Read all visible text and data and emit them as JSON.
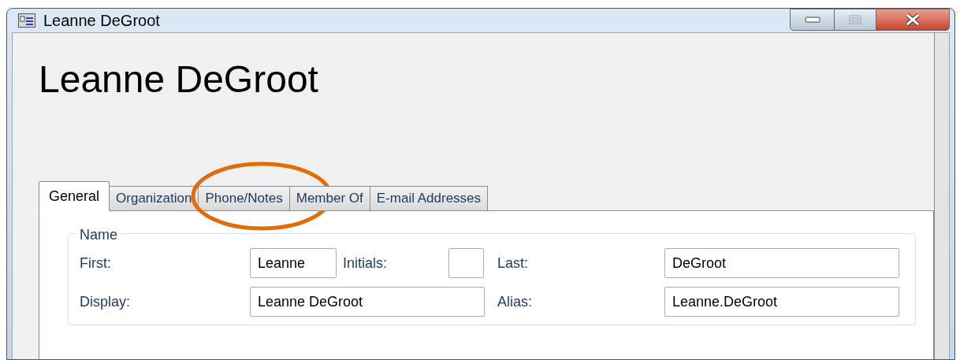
{
  "window": {
    "title": "Leanne DeGroot"
  },
  "heading": "Leanne DeGroot",
  "tabs": [
    {
      "label": "General",
      "selected": true,
      "highlighted": false
    },
    {
      "label": "Organization",
      "selected": false,
      "highlighted": false
    },
    {
      "label": "Phone/Notes",
      "selected": false,
      "highlighted": true
    },
    {
      "label": "Member Of",
      "selected": false,
      "highlighted": false
    },
    {
      "label": "E-mail Addresses",
      "selected": false,
      "highlighted": false
    }
  ],
  "name_group": {
    "title": "Name",
    "first": {
      "label": "First:",
      "value": "Leanne"
    },
    "initials": {
      "label": "Initials:"
    },
    "last": {
      "label": "Last:",
      "value": "DeGroot"
    },
    "display": {
      "label": "Display:",
      "value": "Leanne DeGroot"
    },
    "alias": {
      "label": "Alias:",
      "value": "Leanne.DeGroot"
    }
  }
}
